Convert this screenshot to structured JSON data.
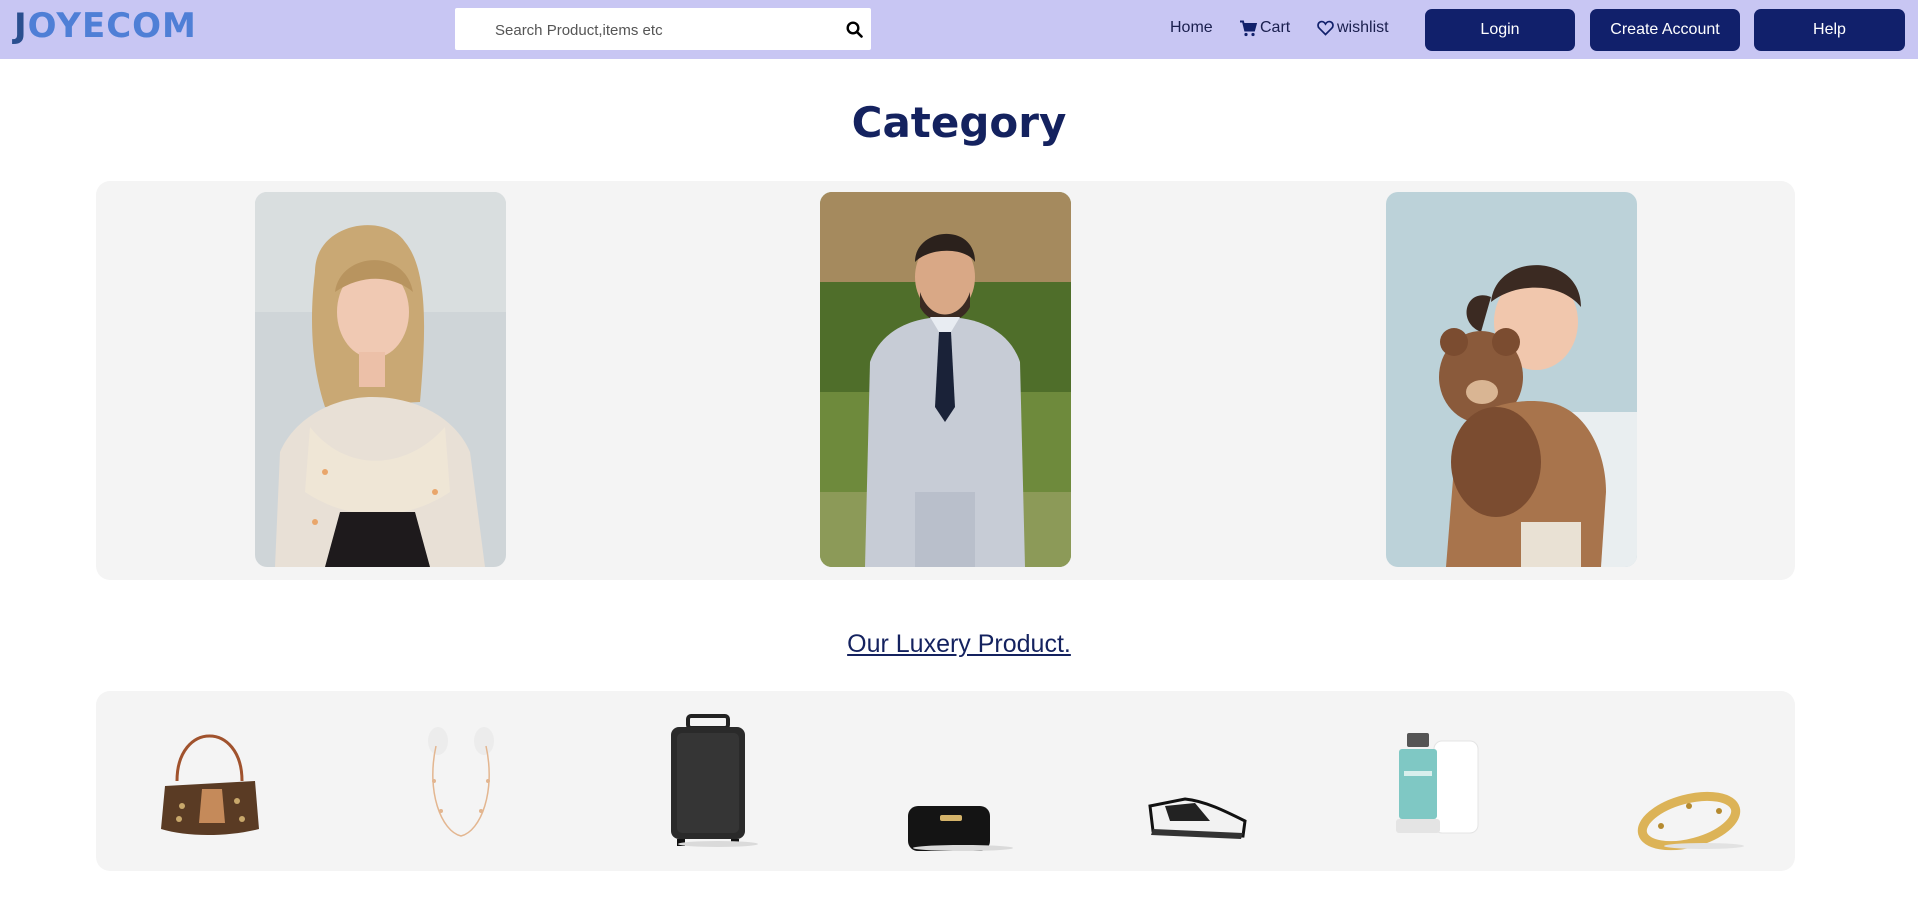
{
  "header": {
    "logo_first": "J",
    "logo_rest": "OYECOM",
    "search_placeholder": "Search Product,items etc",
    "nav": {
      "home": "Home",
      "cart": "Cart",
      "wishlist": "wishlist"
    },
    "buttons": {
      "login": "Login",
      "create_account": "Create Account",
      "help": "Help"
    }
  },
  "category": {
    "title": "Category",
    "cards": [
      "woman",
      "man",
      "child"
    ]
  },
  "luxury": {
    "title": "Our Luxery Product.",
    "products": [
      "handbag",
      "necklace",
      "suitcase",
      "wallet",
      "sneakers",
      "perfume",
      "bracelet"
    ]
  },
  "colors": {
    "header_bg": "#c8c6f3",
    "accent": "#11206b",
    "logo": "#4f7fd6",
    "panel_bg": "#f4f4f4"
  }
}
